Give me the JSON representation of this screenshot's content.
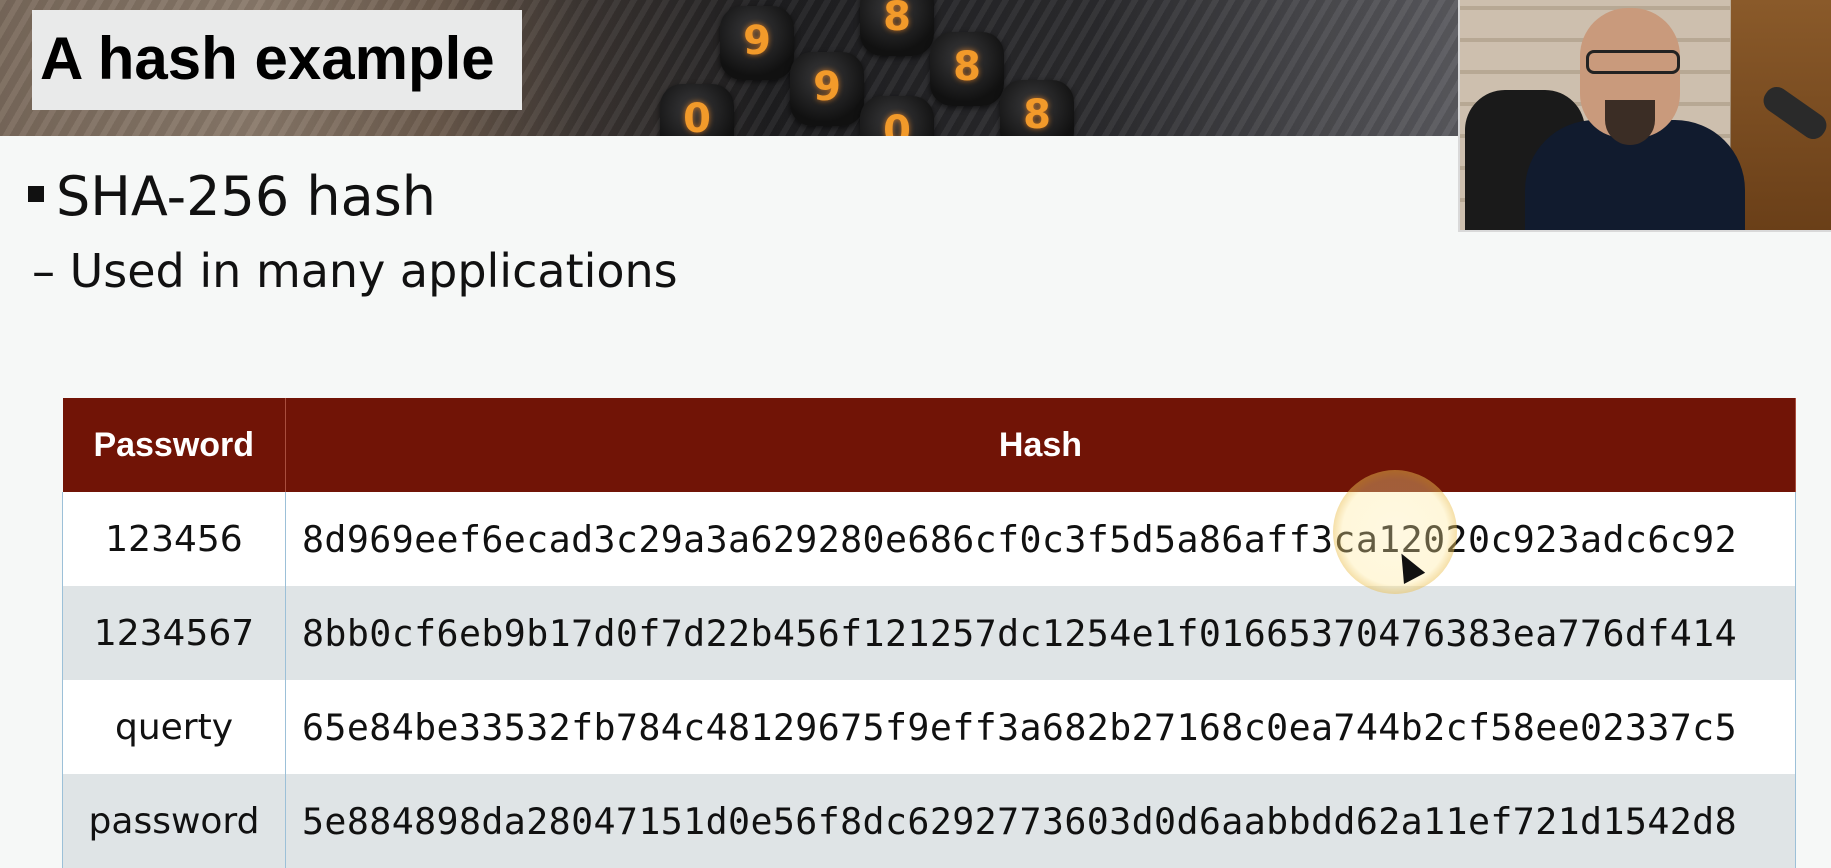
{
  "slide": {
    "title": "A hash example",
    "bullet_main": "SHA-256 hash",
    "bullet_sub": "Used in many applications"
  },
  "banner": {
    "dial_digits": [
      "9",
      "8",
      "9",
      "8",
      "0",
      "8",
      "0"
    ]
  },
  "table": {
    "headers": [
      "Password",
      "Hash"
    ],
    "rows": [
      {
        "password": "123456",
        "hash": "8d969eef6ecad3c29a3a629280e686cf0c3f5d5a86aff3ca12020c923adc6c92"
      },
      {
        "password": "1234567",
        "hash": "8bb0cf6eb9b17d0f7d22b456f121257dc1254e1f01665370476383ea776df414"
      },
      {
        "password": "querty",
        "hash": "65e84be33532fb784c48129675f9eff3a682b27168c0ea744b2cf58ee02337c5"
      },
      {
        "password": "password",
        "hash": "5e884898da28047151d0e56f8dc6292773603d0d6aabbdd62a11ef721d1542d8"
      }
    ]
  },
  "colors": {
    "header_bg": "#711406",
    "row_alt_bg": "#dfe4e6",
    "cursor_highlight": "#f0c24a"
  },
  "icons": {
    "cursor": "mouse-pointer-icon",
    "bullet": "square-bullet-icon"
  }
}
